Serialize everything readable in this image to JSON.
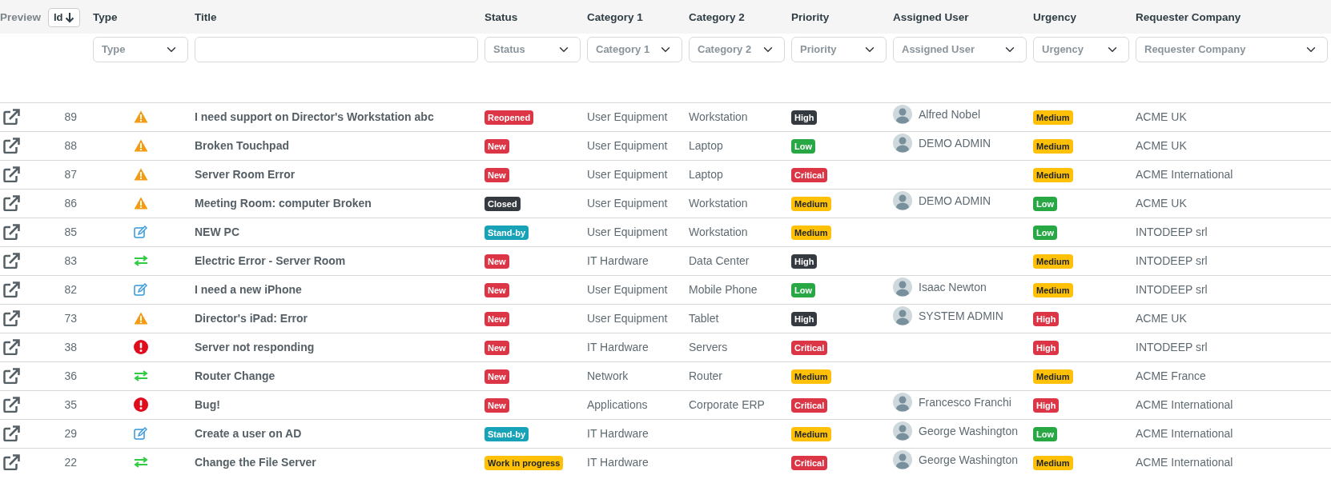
{
  "columns": [
    {
      "label": "Preview",
      "kind": "plain"
    },
    {
      "label": "Id",
      "kind": "sort",
      "sorted": true
    },
    {
      "label": "Type",
      "kind": "dropdown",
      "filter": "Type"
    },
    {
      "label": "Title",
      "kind": "textfield"
    },
    {
      "label": "Status",
      "kind": "dropdown",
      "filter": "Status"
    },
    {
      "label": "Category 1",
      "kind": "dropdown",
      "filter": "Category 1"
    },
    {
      "label": "Category 2",
      "kind": "dropdown",
      "filter": "Category 2"
    },
    {
      "label": "Priority",
      "kind": "dropdown",
      "filter": "Priority"
    },
    {
      "label": "Assigned User",
      "kind": "dropdown",
      "filter": "Assigned User"
    },
    {
      "label": "Urgency",
      "kind": "dropdown",
      "filter": "Urgency"
    },
    {
      "label": "Requester Company",
      "kind": "dropdown",
      "filter": "Requester Company"
    }
  ],
  "rows": [
    {
      "id": "89",
      "kind": "warning",
      "title": "I need support on Director's Workstation abc",
      "status": {
        "text": "Reopened",
        "color": "#dc3545"
      },
      "category_1": "User Equipment",
      "category_2": "Workstation",
      "priority": {
        "text": "High",
        "color": "#343a40"
      },
      "assigned_user": "Alfred Nobel",
      "urgency": {
        "text": "Medium",
        "color": "#ffc107"
      },
      "company": "ACME UK"
    },
    {
      "id": "88",
      "kind": "warning",
      "title": "Broken Touchpad",
      "status": {
        "text": "New",
        "color": "#dc3545"
      },
      "category_1": "User Equipment",
      "category_2": "Laptop",
      "priority": {
        "text": "Low",
        "color": "#28a745"
      },
      "assigned_user": "DEMO ADMIN",
      "urgency": {
        "text": "Medium",
        "color": "#ffc107"
      },
      "company": "ACME UK"
    },
    {
      "id": "87",
      "kind": "warning",
      "title": "Server Room Error",
      "status": {
        "text": "New",
        "color": "#dc3545"
      },
      "category_1": "User Equipment",
      "category_2": "Laptop",
      "priority": {
        "text": "Critical",
        "color": "#dc3545"
      },
      "urgency": {
        "text": "Medium",
        "color": "#ffc107"
      },
      "company": "ACME International"
    },
    {
      "id": "86",
      "kind": "warning",
      "title": "Meeting Room: computer Broken",
      "status": {
        "text": "Closed",
        "color": "#343a40"
      },
      "category_1": "User Equipment",
      "category_2": "Workstation",
      "priority": {
        "text": "Medium",
        "color": "#ffc107"
      },
      "assigned_user": "DEMO ADMIN",
      "urgency": {
        "text": "Low",
        "color": "#28a745"
      },
      "company": "ACME UK"
    },
    {
      "id": "85",
      "kind": "edit",
      "title": "NEW PC",
      "status": {
        "text": "Stand-by",
        "color": "#17a2b8"
      },
      "category_1": "User Equipment",
      "category_2": "Workstation",
      "priority": {
        "text": "Medium",
        "color": "#ffc107"
      },
      "urgency": {
        "text": "Low",
        "color": "#28a745"
      },
      "company": "INTODEEP srl"
    },
    {
      "id": "83",
      "kind": "exchange",
      "title": "Electric Error - Server Room",
      "status": {
        "text": "New",
        "color": "#dc3545"
      },
      "category_1": "IT Hardware",
      "category_2": "Data Center",
      "priority": {
        "text": "High",
        "color": "#343a40"
      },
      "urgency": {
        "text": "Medium",
        "color": "#ffc107"
      },
      "company": "INTODEEP srl"
    },
    {
      "id": "82",
      "kind": "edit",
      "title": "I need a new iPhone",
      "status": {
        "text": "New",
        "color": "#dc3545"
      },
      "category_1": "User Equipment",
      "category_2": "Mobile Phone",
      "priority": {
        "text": "Low",
        "color": "#28a745"
      },
      "assigned_user": "Isaac Newton",
      "urgency": {
        "text": "Medium",
        "color": "#ffc107"
      },
      "company": "INTODEEP srl"
    },
    {
      "id": "73",
      "kind": "warning",
      "title": "Director's iPad: Error",
      "status": {
        "text": "New",
        "color": "#dc3545"
      },
      "category_1": "User Equipment",
      "category_2": "Tablet",
      "priority": {
        "text": "High",
        "color": "#343a40"
      },
      "assigned_user": "SYSTEM ADMIN",
      "urgency": {
        "text": "High",
        "color": "#dc3545"
      },
      "company": "ACME UK"
    },
    {
      "id": "38",
      "kind": "alert",
      "title": "Server not responding",
      "status": {
        "text": "New",
        "color": "#dc3545"
      },
      "category_1": "IT Hardware",
      "category_2": "Servers",
      "priority": {
        "text": "Critical",
        "color": "#dc3545"
      },
      "urgency": {
        "text": "High",
        "color": "#dc3545"
      },
      "company": "INTODEEP srl"
    },
    {
      "id": "36",
      "kind": "exchange",
      "title": "Router Change",
      "status": {
        "text": "New",
        "color": "#dc3545"
      },
      "category_1": "Network",
      "category_2": "Router",
      "priority": {
        "text": "Medium",
        "color": "#ffc107"
      },
      "urgency": {
        "text": "Medium",
        "color": "#ffc107"
      },
      "company": "ACME France"
    },
    {
      "id": "35",
      "kind": "alert",
      "title": "Bug!",
      "status": {
        "text": "New",
        "color": "#dc3545"
      },
      "category_1": "Applications",
      "category_2": "Corporate ERP",
      "priority": {
        "text": "Critical",
        "color": "#dc3545"
      },
      "assigned_user": "Francesco Franchi",
      "urgency": {
        "text": "High",
        "color": "#dc3545"
      },
      "company": "ACME International"
    },
    {
      "id": "29",
      "kind": "edit",
      "title": "Create a user on AD",
      "status": {
        "text": "Stand-by",
        "color": "#17a2b8"
      },
      "category_1": "IT Hardware",
      "priority": {
        "text": "Medium",
        "color": "#ffc107"
      },
      "assigned_user": "George Washington",
      "urgency": {
        "text": "Low",
        "color": "#28a745"
      },
      "company": "ACME International"
    },
    {
      "id": "22",
      "kind": "exchange",
      "title": "Change the File Server",
      "status": {
        "text": "Work in progress",
        "color": "#ffc107"
      },
      "category_1": "IT Hardware",
      "priority": {
        "text": "Critical",
        "color": "#dc3545"
      },
      "assigned_user": "George Washington",
      "urgency": {
        "text": "Medium",
        "color": "#ffc107"
      },
      "company": "ACME International"
    }
  ]
}
